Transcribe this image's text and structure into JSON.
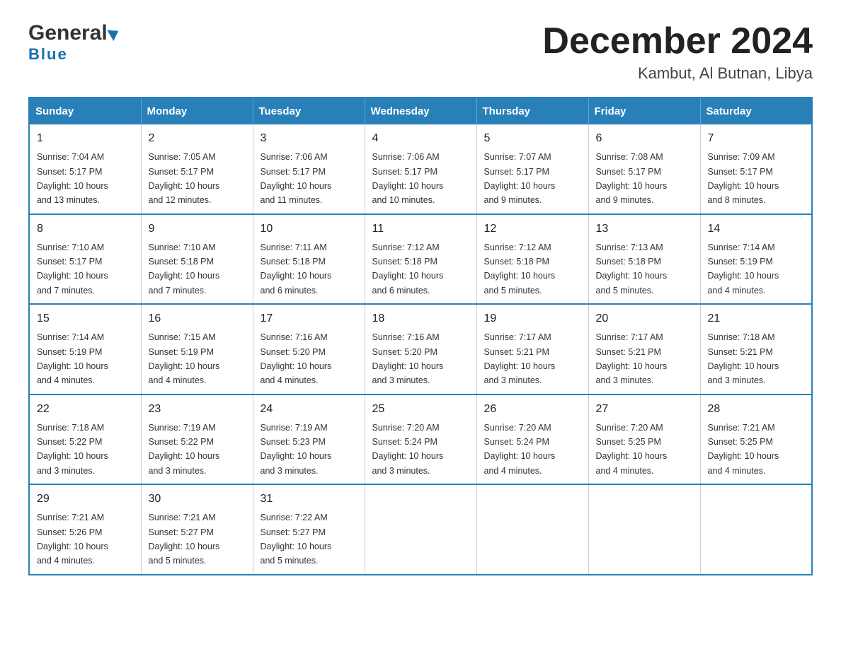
{
  "header": {
    "logo_general": "General",
    "logo_blue": "Blue",
    "month": "December 2024",
    "location": "Kambut, Al Butnan, Libya"
  },
  "days_of_week": [
    "Sunday",
    "Monday",
    "Tuesday",
    "Wednesday",
    "Thursday",
    "Friday",
    "Saturday"
  ],
  "weeks": [
    [
      {
        "day": "1",
        "sunrise": "7:04 AM",
        "sunset": "5:17 PM",
        "daylight": "10 hours and 13 minutes."
      },
      {
        "day": "2",
        "sunrise": "7:05 AM",
        "sunset": "5:17 PM",
        "daylight": "10 hours and 12 minutes."
      },
      {
        "day": "3",
        "sunrise": "7:06 AM",
        "sunset": "5:17 PM",
        "daylight": "10 hours and 11 minutes."
      },
      {
        "day": "4",
        "sunrise": "7:06 AM",
        "sunset": "5:17 PM",
        "daylight": "10 hours and 10 minutes."
      },
      {
        "day": "5",
        "sunrise": "7:07 AM",
        "sunset": "5:17 PM",
        "daylight": "10 hours and 9 minutes."
      },
      {
        "day": "6",
        "sunrise": "7:08 AM",
        "sunset": "5:17 PM",
        "daylight": "10 hours and 9 minutes."
      },
      {
        "day": "7",
        "sunrise": "7:09 AM",
        "sunset": "5:17 PM",
        "daylight": "10 hours and 8 minutes."
      }
    ],
    [
      {
        "day": "8",
        "sunrise": "7:10 AM",
        "sunset": "5:17 PM",
        "daylight": "10 hours and 7 minutes."
      },
      {
        "day": "9",
        "sunrise": "7:10 AM",
        "sunset": "5:18 PM",
        "daylight": "10 hours and 7 minutes."
      },
      {
        "day": "10",
        "sunrise": "7:11 AM",
        "sunset": "5:18 PM",
        "daylight": "10 hours and 6 minutes."
      },
      {
        "day": "11",
        "sunrise": "7:12 AM",
        "sunset": "5:18 PM",
        "daylight": "10 hours and 6 minutes."
      },
      {
        "day": "12",
        "sunrise": "7:12 AM",
        "sunset": "5:18 PM",
        "daylight": "10 hours and 5 minutes."
      },
      {
        "day": "13",
        "sunrise": "7:13 AM",
        "sunset": "5:18 PM",
        "daylight": "10 hours and 5 minutes."
      },
      {
        "day": "14",
        "sunrise": "7:14 AM",
        "sunset": "5:19 PM",
        "daylight": "10 hours and 4 minutes."
      }
    ],
    [
      {
        "day": "15",
        "sunrise": "7:14 AM",
        "sunset": "5:19 PM",
        "daylight": "10 hours and 4 minutes."
      },
      {
        "day": "16",
        "sunrise": "7:15 AM",
        "sunset": "5:19 PM",
        "daylight": "10 hours and 4 minutes."
      },
      {
        "day": "17",
        "sunrise": "7:16 AM",
        "sunset": "5:20 PM",
        "daylight": "10 hours and 4 minutes."
      },
      {
        "day": "18",
        "sunrise": "7:16 AM",
        "sunset": "5:20 PM",
        "daylight": "10 hours and 3 minutes."
      },
      {
        "day": "19",
        "sunrise": "7:17 AM",
        "sunset": "5:21 PM",
        "daylight": "10 hours and 3 minutes."
      },
      {
        "day": "20",
        "sunrise": "7:17 AM",
        "sunset": "5:21 PM",
        "daylight": "10 hours and 3 minutes."
      },
      {
        "day": "21",
        "sunrise": "7:18 AM",
        "sunset": "5:21 PM",
        "daylight": "10 hours and 3 minutes."
      }
    ],
    [
      {
        "day": "22",
        "sunrise": "7:18 AM",
        "sunset": "5:22 PM",
        "daylight": "10 hours and 3 minutes."
      },
      {
        "day": "23",
        "sunrise": "7:19 AM",
        "sunset": "5:22 PM",
        "daylight": "10 hours and 3 minutes."
      },
      {
        "day": "24",
        "sunrise": "7:19 AM",
        "sunset": "5:23 PM",
        "daylight": "10 hours and 3 minutes."
      },
      {
        "day": "25",
        "sunrise": "7:20 AM",
        "sunset": "5:24 PM",
        "daylight": "10 hours and 3 minutes."
      },
      {
        "day": "26",
        "sunrise": "7:20 AM",
        "sunset": "5:24 PM",
        "daylight": "10 hours and 4 minutes."
      },
      {
        "day": "27",
        "sunrise": "7:20 AM",
        "sunset": "5:25 PM",
        "daylight": "10 hours and 4 minutes."
      },
      {
        "day": "28",
        "sunrise": "7:21 AM",
        "sunset": "5:25 PM",
        "daylight": "10 hours and 4 minutes."
      }
    ],
    [
      {
        "day": "29",
        "sunrise": "7:21 AM",
        "sunset": "5:26 PM",
        "daylight": "10 hours and 4 minutes."
      },
      {
        "day": "30",
        "sunrise": "7:21 AM",
        "sunset": "5:27 PM",
        "daylight": "10 hours and 5 minutes."
      },
      {
        "day": "31",
        "sunrise": "7:22 AM",
        "sunset": "5:27 PM",
        "daylight": "10 hours and 5 minutes."
      },
      null,
      null,
      null,
      null
    ]
  ],
  "labels": {
    "sunrise": "Sunrise:",
    "sunset": "Sunset:",
    "daylight": "Daylight:"
  }
}
